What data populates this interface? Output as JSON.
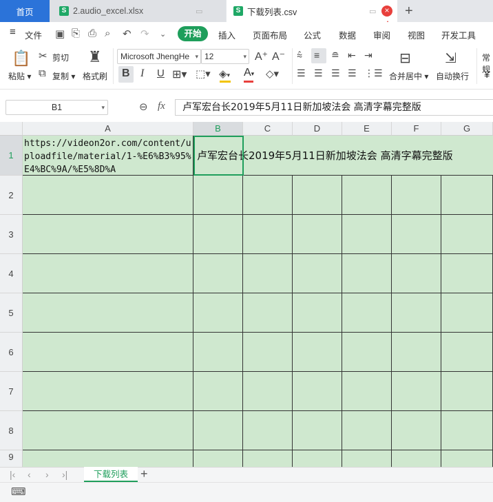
{
  "tabs": {
    "home": "首页",
    "file1": "2.audio_excel.xlsx",
    "file2": "下载列表.csv",
    "file_icon_letter": "S"
  },
  "menu": {
    "file": "文件",
    "start": "开始",
    "insert": "插入",
    "layout": "页面布局",
    "formula": "公式",
    "data": "数据",
    "review": "审阅",
    "view": "视图",
    "dev": "开发工具"
  },
  "ribbon": {
    "paste": "粘贴",
    "cut": "剪切",
    "copy": "复制",
    "format_painter": "格式刷",
    "font_name": "Microsoft JhengHe",
    "font_size": "12",
    "bold": "B",
    "italic": "I",
    "underline": "U",
    "merge_center": "合并居中",
    "wrap_text": "自动换行",
    "normal": "常规"
  },
  "formula_bar": {
    "name_box": "B1",
    "fx": "fx",
    "content": "卢军宏台长2019年5月11日新加坡法会 高清字幕完整版"
  },
  "grid": {
    "columns": [
      "A",
      "B",
      "C",
      "D",
      "E",
      "F",
      "G"
    ],
    "rows": [
      "1",
      "2",
      "3",
      "4",
      "5",
      "6",
      "7",
      "8",
      "9"
    ],
    "a1": "https://videon2or.com/content/uploadfile/material/1-%E6%B3%95%E4%BC%9A/%E5%8D%A",
    "b1": "卢军宏台长2019年5月11日新加坡法会 高清字幕完整版",
    "fill_color": "#cfe8cf"
  },
  "sheets": {
    "active": "下载列表"
  },
  "colors": {
    "accent": "#1e9e5b",
    "home_tab": "#2b73d9",
    "close": "#e8403c"
  }
}
